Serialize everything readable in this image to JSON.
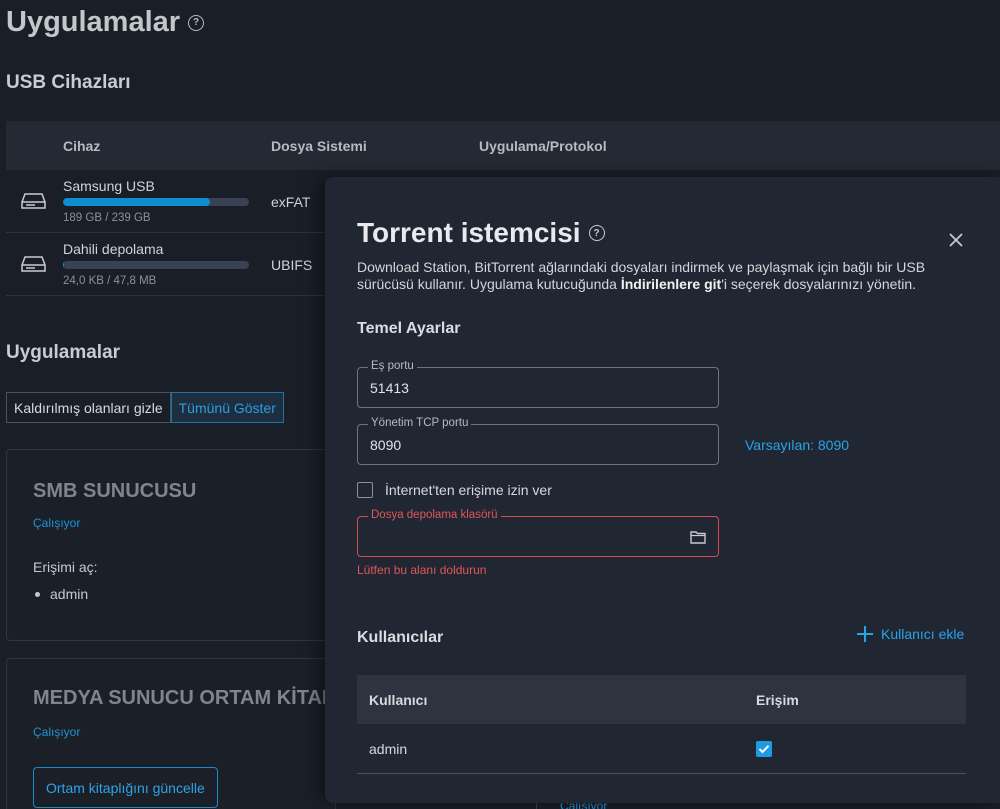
{
  "page": {
    "title": "Uygulamalar"
  },
  "usb": {
    "section_title": "USB Cihazları",
    "columns": [
      "Cihaz",
      "Dosya Sistemi",
      "Uygulama/Protokol"
    ],
    "devices": [
      {
        "name": "Samsung USB",
        "usage_fraction": 0.79,
        "size": "189 GB / 239 GB",
        "fs": "exFAT"
      },
      {
        "name": "Dahili depolama",
        "usage_fraction": 0.0005,
        "size": "24,0 KB / 47,8 MB",
        "fs": "UBIFS"
      }
    ]
  },
  "apps": {
    "section_title": "Uygulamalar",
    "filter_hide_removed": "Kaldırılmış olanları gizle",
    "filter_show_all": "Tümünü Göster",
    "smb": {
      "title": "SMB SUNUCUSU",
      "status": "Çalışıyor",
      "access_label": "Erişimi aç:",
      "users": [
        "admin"
      ]
    },
    "media": {
      "title": "MEDYA SUNUCU ORTAM KİTAPLIĞI",
      "status": "Çalışıyor",
      "update_button": "Ortam kitaplığını güncelle"
    },
    "behind_status": "Çalışıyor"
  },
  "modal": {
    "title": "Torrent istemcisi",
    "description_pre": "Download Station, BitTorrent ağlarındaki dosyaları indirmek ve paylaşmak için bağlı bir USB sürücüsü kullanır. Uygulama kutucuğunda ",
    "description_bold": "İndirilenlere git",
    "description_post": "'i seçerek dosyalarınızı yönetin.",
    "basic_settings": "Temel Ayarlar",
    "peer_port_label": "Eş portu",
    "peer_port_value": "51413",
    "admin_port_label": "Yönetim TCP portu",
    "admin_port_value": "8090",
    "default_hint": "Varsayılan: 8090",
    "internet_access_label": "İnternet'ten erişime izin ver",
    "internet_access_checked": false,
    "storage_folder_label": "Dosya depolama klasörü",
    "storage_folder_value": "",
    "storage_error": "Lütfen bu alanı doldurun",
    "users_title": "Kullanıcılar",
    "add_user": "Kullanıcı ekle",
    "user_columns": [
      "Kullanıcı",
      "Erişim"
    ],
    "users": [
      {
        "name": "admin",
        "access": true
      }
    ]
  },
  "colors": {
    "accent": "#1e9be5",
    "error": "#d9484f",
    "background": "#1a1f27",
    "modal_background": "#202732"
  }
}
